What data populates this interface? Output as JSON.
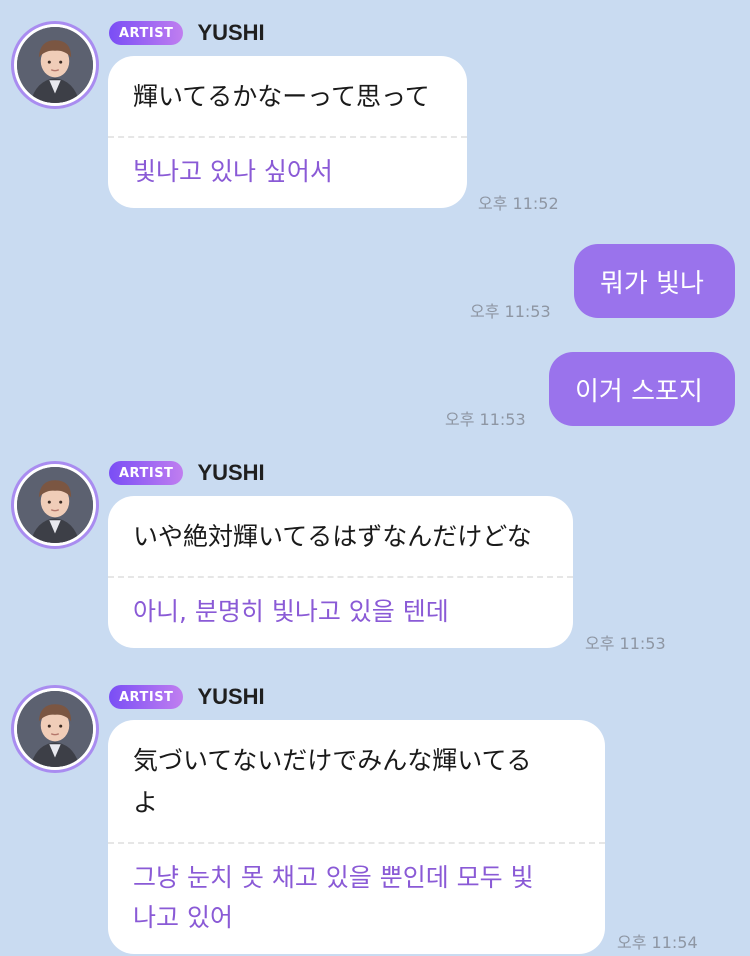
{
  "badge_label": "ARTIST",
  "sender_name": "YUSHI",
  "messages": [
    {
      "orig": "輝いてるかなーって思って",
      "trans": "빛나고 있나 싶어서",
      "time": "오후 11:52"
    },
    {
      "text": "뭐가 빛나",
      "time": "오후 11:53"
    },
    {
      "text": "이거 스포지",
      "time": "오후 11:53"
    },
    {
      "orig": "いや絶対輝いてるはずなんだけどな",
      "trans": "아니, 분명히 빛나고 있을 텐데",
      "time": "오후 11:53"
    },
    {
      "orig_line1": "気づいてないだけでみんな輝いてる",
      "orig_line2": "よ",
      "trans_line1": "그냥 눈치 못 채고 있을 뿐인데 모두 빛",
      "trans_line2": "나고 있어",
      "time": "오후 11:54"
    }
  ],
  "colors": {
    "background": "#c9dbf1",
    "received_bubble": "#ffffff",
    "sent_bubble": "#9a73ec",
    "translation_text": "#8a5ad6",
    "badge_gradient": [
      "#7a4ef5",
      "#c07ef0"
    ]
  }
}
